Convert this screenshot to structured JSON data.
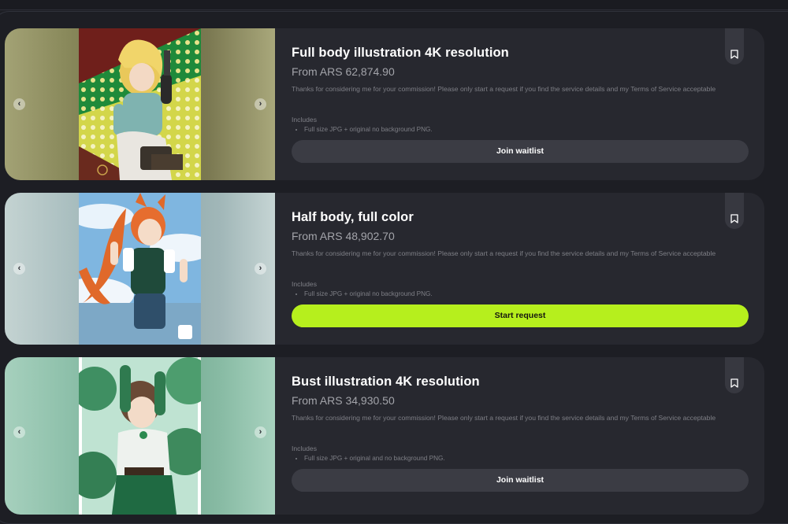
{
  "listings": [
    {
      "title": "Full body illustration 4K resolution",
      "price": "From ARS 62,874.90",
      "description": "Thanks for considering me for your commission! Please only start a request if you find the service details and my Terms of Service acceptable",
      "includes_label": "Includes",
      "includes": [
        "Full size JPG + original no background PNG."
      ],
      "button": "Join waitlist",
      "button_style": "secondary",
      "accent": "#9a9a6a"
    },
    {
      "title": "Half body, full color",
      "price": "From ARS 48,902.70",
      "description": "Thanks for considering me for your commission! Please only start a request if you find the service details and my Terms of Service acceptable",
      "includes_label": "Includes",
      "includes": [
        "Full size JPG + original no background PNG."
      ],
      "button": "Start request",
      "button_style": "primary",
      "accent": "#b6ef1d"
    },
    {
      "title": "Bust illustration 4K resolution",
      "price": "From ARS 34,930.50",
      "description": "Thanks for considering me for your commission! Please only start a request if you find the service details and my Terms of Service acceptable",
      "includes_label": "Includes",
      "includes": [
        "Full size JPG + original and no background PNG."
      ],
      "button": "Join waitlist",
      "button_style": "secondary",
      "accent": "#8fc4ac"
    }
  ],
  "icons": {
    "prev": "chevron-left-icon",
    "next": "chevron-right-icon",
    "bookmark": "bookmark-icon"
  }
}
